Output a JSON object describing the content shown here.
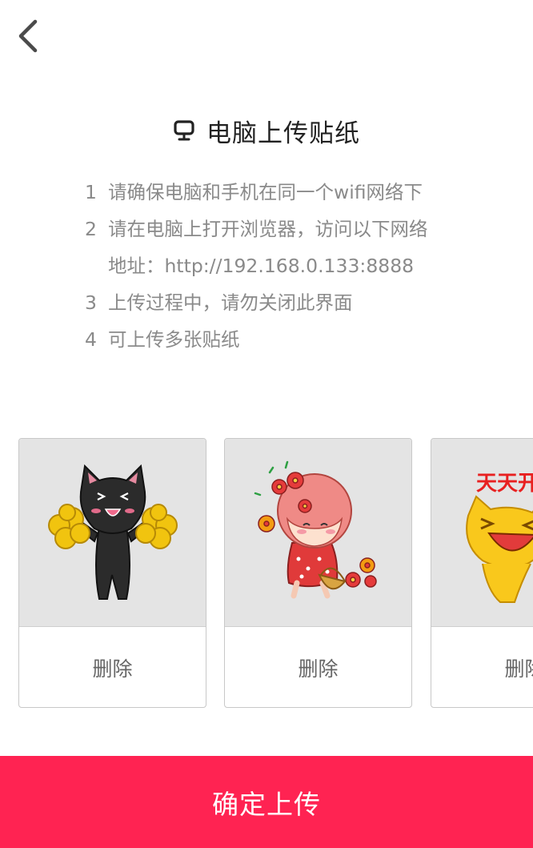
{
  "header": {
    "back_icon": "chevron-left-icon",
    "title_icon": "monitor-icon",
    "title": "电脑上传贴纸"
  },
  "steps": [
    {
      "num": "1",
      "text": "请确保电脑和手机在同一个wifi网络下"
    },
    {
      "num": "2",
      "text": "请在电脑上打开浏览器，访问以下网络",
      "cont": "地址：http://192.168.0.133:8888"
    },
    {
      "num": "3",
      "text": "上传过程中，请勿关闭此界面"
    },
    {
      "num": "4",
      "text": "可上传多张贴纸"
    }
  ],
  "stickers": [
    {
      "image": "black-cat-cheerleader-sticker",
      "delete_label": "删除"
    },
    {
      "image": "red-hood-girl-flowers-sticker",
      "delete_label": "删除"
    },
    {
      "image": "yellow-cat-laughing-sticker",
      "image_text": "天天开",
      "delete_label": "删除"
    }
  ],
  "footer": {
    "confirm_label": "确定上传"
  },
  "colors": {
    "accent": "#ff2352",
    "step_text": "#8a8a8a",
    "card_bg": "#e4e4e4"
  }
}
